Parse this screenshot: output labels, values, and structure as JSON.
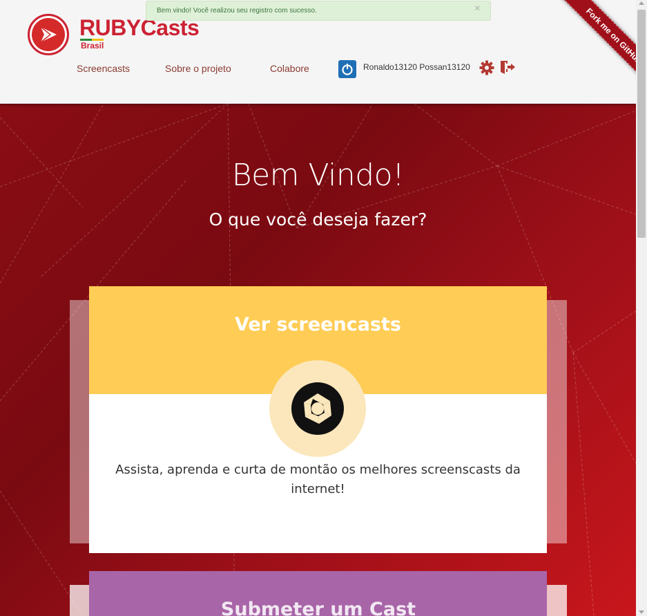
{
  "flash": {
    "message": "Bem vindo! Você realizou seu registro com sucesso.",
    "close": "×"
  },
  "brand": {
    "name": "RUBYCasts",
    "sub": "Brasil",
    "logo_icon": "play-arrow-icon"
  },
  "nav": {
    "items": [
      {
        "label": "Screencasts"
      },
      {
        "label": "Sobre o projeto"
      },
      {
        "label": "Colabore"
      }
    ]
  },
  "user": {
    "avatar_icon": "power-icon",
    "name": "Ronaldo13120 Possan13120",
    "settings_icon": "gear-icon",
    "logout_icon": "logout-icon"
  },
  "ribbon": {
    "label": "Fork me on GitHub"
  },
  "hero": {
    "title": "Bem Vindo!",
    "subtitle": "O que você deseja fazer?"
  },
  "cards": [
    {
      "title": "Ver screencasts",
      "icon": "aperture-icon",
      "text": "Assista, aprenda e curta de montão os melhores screenscasts da internet!",
      "color": "#ffcc55"
    },
    {
      "title": "Submeter um Cast",
      "color": "#a865a8"
    }
  ],
  "colors": {
    "brand": "#cc2233",
    "hero": "#8a0d14",
    "flash_bg": "#dff0d8"
  }
}
